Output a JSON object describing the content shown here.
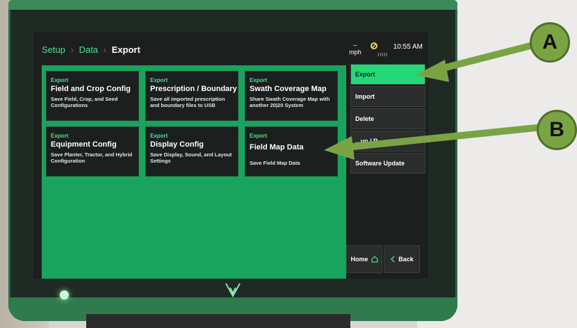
{
  "breadcrumb": {
    "items": [
      "Setup",
      "Data"
    ],
    "separator": "›",
    "current": "Export"
  },
  "status": {
    "speed_value": "--",
    "speed_unit": "mph",
    "time": "10:55 AM",
    "signal": "IIIII"
  },
  "cards": [
    {
      "kicker": "Export",
      "title": "Field and Crop Config",
      "desc": "Save Field, Crop, and Seed Configurations"
    },
    {
      "kicker": "Export",
      "title": "Prescription / Boundary",
      "desc": "Save all imported prescription and boundary files to USB"
    },
    {
      "kicker": "Export",
      "title": "Swath Coverage Map",
      "desc": "Share Swath Coverage Map with another 20|20 System"
    },
    {
      "kicker": "Export",
      "title": "Equipment Config",
      "desc": "Save Planter, Tractor, and Hybrid Configuration"
    },
    {
      "kicker": "Export",
      "title": "Display Config",
      "desc": "Save Display, Sound, and Layout Settings"
    },
    {
      "kicker": "Export",
      "title": "Field Map Data",
      "desc": "Save Field Map Data"
    }
  ],
  "sidebar": {
    "items": [
      {
        "label": "Export"
      },
      {
        "label": "Import"
      },
      {
        "label": "Delete"
      },
      {
        "label": "...up / R..."
      },
      {
        "label": "Software Update"
      }
    ]
  },
  "footer": {
    "home_label": "Home",
    "back_label": "Back"
  },
  "annotations": {
    "a": "A",
    "b": "B",
    "color": "#7aa443"
  },
  "colors": {
    "accent": "#4fe08f",
    "content_bg": "#18a45c",
    "active_tab": "#22d877"
  }
}
